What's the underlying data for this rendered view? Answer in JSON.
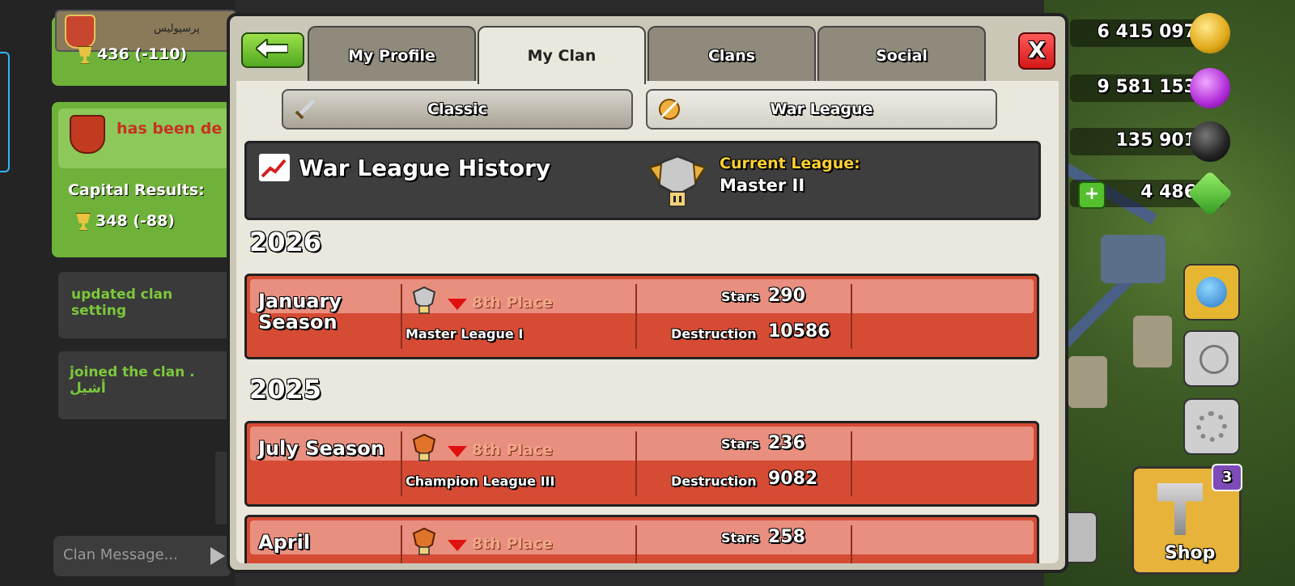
{
  "chat": {
    "clan_name": "پرسپولیس",
    "trophies_top": "436 (-110)",
    "event_text": "has been de",
    "capital_label": "Capital Results:",
    "capital_value": "348 (-88)",
    "msg_settings": "updated clan setting",
    "msg_joined": "joined the clan . أشيل",
    "input_placeholder": "Clan Message..."
  },
  "resources": {
    "gold": "6 415 097",
    "elixir": "9 581 153",
    "dark_elixir": "135 901",
    "gems": "4 486"
  },
  "shop": {
    "label": "Shop",
    "badge": "3"
  },
  "tabs": [
    {
      "label": "My Profile"
    },
    {
      "label": "My Clan"
    },
    {
      "label": "Clans"
    },
    {
      "label": "Social"
    }
  ],
  "close_label": "X",
  "subtabs": {
    "classic": "Classic",
    "war_league": "War League"
  },
  "history": {
    "title": "War League History",
    "current_label": "Current League:",
    "current_value": "Master II"
  },
  "years": [
    "2026",
    "2025"
  ],
  "seasons": [
    {
      "name": "January Season",
      "place": "8th Place",
      "league": "Master League I",
      "stars_label": "Stars",
      "stars": "290",
      "destruction_label": "Destruction",
      "destruction": "10586"
    },
    {
      "name": "July Season",
      "place": "8th Place",
      "league": "Champion League III",
      "stars_label": "Stars",
      "stars": "236",
      "destruction_label": "Destruction",
      "destruction": "9082"
    },
    {
      "name": "April",
      "place": "8th Place",
      "stars_label": "Stars",
      "stars": "258"
    }
  ],
  "colors": {
    "row_red": "#d64b33",
    "current_league_gold": "#ffd233",
    "back_green": "#53a822",
    "close_red": "#d41717"
  }
}
